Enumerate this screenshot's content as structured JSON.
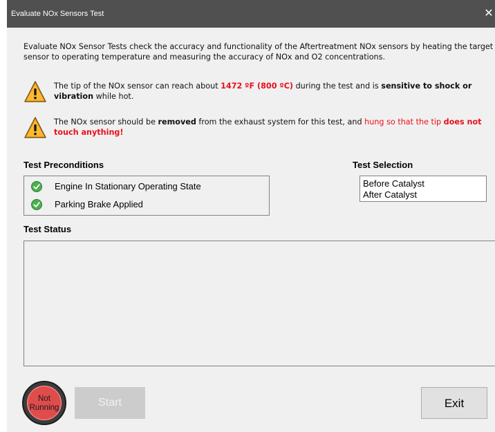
{
  "window": {
    "title": "Evaluate NOx Sensors Test",
    "close_glyph": "✕"
  },
  "intro_text": "Evaluate NOx Sensor Tests check the accuracy and functionality of the Aftertreatment NOx sensors by heating the target sensor to operating temperature and measuring the accuracy of NOx and O2 concentrations.",
  "warnings": [
    {
      "icon": "warning-icon",
      "parts": [
        "The tip of the NOx sensor can reach about ",
        "1472 ºF (800 ºC)",
        " during the test and is ",
        "sensitive to shock or vibration",
        " while hot."
      ]
    },
    {
      "icon": "warning-icon",
      "parts": [
        "The NOx sensor should be ",
        "removed",
        " from the exhaust system for this test, and ",
        "hung so that the tip ",
        "does not touch anything!"
      ]
    }
  ],
  "preconditions": {
    "label": "Test Preconditions",
    "items": [
      {
        "label": "Engine In Stationary Operating State",
        "icon": "check-icon"
      },
      {
        "label": "Parking Brake Applied",
        "icon": "check-icon"
      }
    ]
  },
  "test_selection": {
    "label": "Test Selection",
    "options": [
      "Before Catalyst",
      "After Catalyst"
    ]
  },
  "test_status": {
    "label": "Test Status"
  },
  "indicator": {
    "line1": "Not",
    "line2": "Running"
  },
  "buttons": {
    "start": "Start",
    "exit": "Exit"
  },
  "colors": {
    "titlebar": "#505050",
    "warning_red": "#e8101a",
    "indicator_red": "#e04c4c",
    "check_green": "#4caf50"
  }
}
